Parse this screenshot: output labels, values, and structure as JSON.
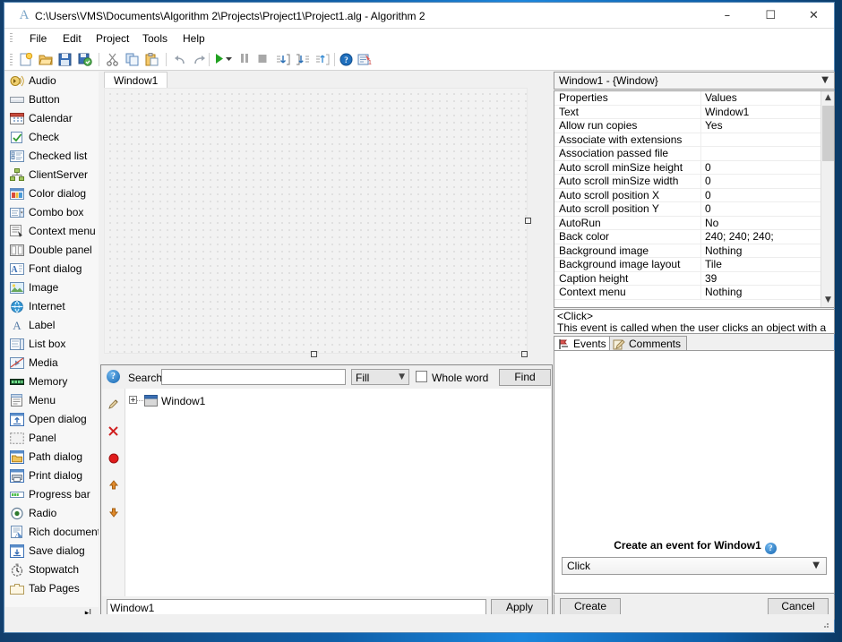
{
  "window": {
    "title": "C:\\Users\\VMS\\Documents\\Algorithm 2\\Projects\\Project1\\Project1.alg - Algorithm 2",
    "app_icon_glyph": "A",
    "minimize": "–",
    "maximize": "☐",
    "close": "✕"
  },
  "menubar": {
    "items": [
      {
        "label": "File"
      },
      {
        "label": "Edit"
      },
      {
        "label": "Project"
      },
      {
        "label": "Tools"
      },
      {
        "label": "Help"
      }
    ]
  },
  "toolbar": {
    "buttons": [
      {
        "name": "new-file-icon",
        "title": "New"
      },
      {
        "name": "open-folder-icon",
        "title": "Open"
      },
      {
        "name": "save-icon",
        "title": "Save"
      },
      {
        "name": "save-all-icon",
        "title": "Save all"
      },
      {
        "name": "cut-icon",
        "title": "Cut"
      },
      {
        "name": "copy-icon",
        "title": "Copy"
      },
      {
        "name": "paste-icon",
        "title": "Paste"
      },
      {
        "name": "undo-icon",
        "title": "Undo"
      },
      {
        "name": "redo-icon",
        "title": "Redo"
      },
      {
        "name": "run-icon",
        "title": "Run"
      },
      {
        "name": "run-dropdown-icon",
        "title": "Run options"
      },
      {
        "name": "pause-icon",
        "title": "Pause"
      },
      {
        "name": "stop-icon",
        "title": "Stop"
      },
      {
        "name": "step-into-icon",
        "title": "Step into"
      },
      {
        "name": "step-over-icon",
        "title": "Step over"
      },
      {
        "name": "step-out-icon",
        "title": "Step out"
      },
      {
        "name": "help-icon",
        "title": "Help"
      },
      {
        "name": "todo-icon",
        "title": "Tasks"
      }
    ]
  },
  "toolbox": {
    "items": [
      {
        "label": "Audio",
        "icon": "audio-icon"
      },
      {
        "label": "Button",
        "icon": "button-icon"
      },
      {
        "label": "Calendar",
        "icon": "calendar-icon"
      },
      {
        "label": "Check",
        "icon": "check-icon"
      },
      {
        "label": "Checked list",
        "icon": "checked-list-icon"
      },
      {
        "label": "ClientServer",
        "icon": "client-server-icon"
      },
      {
        "label": "Color dialog",
        "icon": "color-dialog-icon"
      },
      {
        "label": "Combo box",
        "icon": "combo-box-icon"
      },
      {
        "label": "Context menu",
        "icon": "context-menu-icon"
      },
      {
        "label": "Double panel",
        "icon": "double-panel-icon"
      },
      {
        "label": "Font dialog",
        "icon": "font-dialog-icon"
      },
      {
        "label": "Image",
        "icon": "image-icon"
      },
      {
        "label": "Internet",
        "icon": "internet-icon"
      },
      {
        "label": "Label",
        "icon": "label-icon"
      },
      {
        "label": "List box",
        "icon": "list-box-icon"
      },
      {
        "label": "Media",
        "icon": "media-icon"
      },
      {
        "label": "Memory",
        "icon": "memory-icon"
      },
      {
        "label": "Menu",
        "icon": "menu-icon"
      },
      {
        "label": "Open dialog",
        "icon": "open-dialog-icon"
      },
      {
        "label": "Panel",
        "icon": "panel-icon"
      },
      {
        "label": "Path dialog",
        "icon": "path-dialog-icon"
      },
      {
        "label": "Print dialog",
        "icon": "print-dialog-icon"
      },
      {
        "label": "Progress bar",
        "icon": "progress-bar-icon"
      },
      {
        "label": "Radio",
        "icon": "radio-icon"
      },
      {
        "label": "Rich document",
        "icon": "rich-document-icon"
      },
      {
        "label": "Save dialog",
        "icon": "save-dialog-icon"
      },
      {
        "label": "Stopwatch",
        "icon": "stopwatch-icon"
      },
      {
        "label": "Tab Pages",
        "icon": "tab-pages-icon"
      }
    ],
    "expand_glyph": "▸|"
  },
  "designer": {
    "tab_label": "Window1"
  },
  "search": {
    "label": "Search:",
    "value": "",
    "placeholder": "",
    "scope_selected": "Fill",
    "whole_word_label": "Whole word",
    "whole_word_checked": false,
    "find_label": "Find"
  },
  "tree": {
    "expand_glyph": "+",
    "root_label": "Window1"
  },
  "vtools": {
    "buttons": [
      {
        "name": "edit-pencil-icon"
      },
      {
        "name": "delete-x-icon"
      },
      {
        "name": "breakpoint-icon"
      },
      {
        "name": "move-up-icon"
      },
      {
        "name": "move-down-icon"
      }
    ]
  },
  "bottom": {
    "name_value": "Window1",
    "apply_label": "Apply"
  },
  "properties": {
    "selector_label": "Window1 - {Window}",
    "header": {
      "name": "Properties",
      "value": "Values"
    },
    "rows": [
      {
        "name": "Text",
        "value": "Window1"
      },
      {
        "name": "Allow run copies",
        "value": "Yes"
      },
      {
        "name": "Associate with extensions",
        "value": ""
      },
      {
        "name": "Association passed file",
        "value": ""
      },
      {
        "name": "Auto scroll minSize height",
        "value": "0"
      },
      {
        "name": "Auto scroll minSize width",
        "value": "0"
      },
      {
        "name": "Auto scroll position X",
        "value": "0"
      },
      {
        "name": "Auto scroll position Y",
        "value": "0"
      },
      {
        "name": "AutoRun",
        "value": "No"
      },
      {
        "name": "Back color",
        "value": "240; 240; 240;"
      },
      {
        "name": "Background image",
        "value": "Nothing"
      },
      {
        "name": "Background image layout",
        "value": "Tile"
      },
      {
        "name": "Caption height",
        "value": "39"
      },
      {
        "name": "Context menu",
        "value": "Nothing"
      }
    ]
  },
  "event_description": {
    "name": "<Click>",
    "text": "This event is called when the user clicks an object with a mouse..."
  },
  "notebook": {
    "tabs": [
      {
        "label": "Events",
        "icon": "events-icon",
        "active": true
      },
      {
        "label": "Comments",
        "icon": "comments-icon",
        "active": false
      }
    ]
  },
  "create_event": {
    "title": "Create an event for Window1",
    "help_glyph": "?",
    "selected": "Click"
  },
  "right_buttons": {
    "create_label": "Create",
    "cancel_label": "Cancel"
  },
  "colors": {
    "accent": "#1b86dd",
    "window_bg": "#f0f0f0",
    "panel_border": "#9a9a9a",
    "run_green": "#21a121",
    "delete_red": "#d01f1f"
  }
}
